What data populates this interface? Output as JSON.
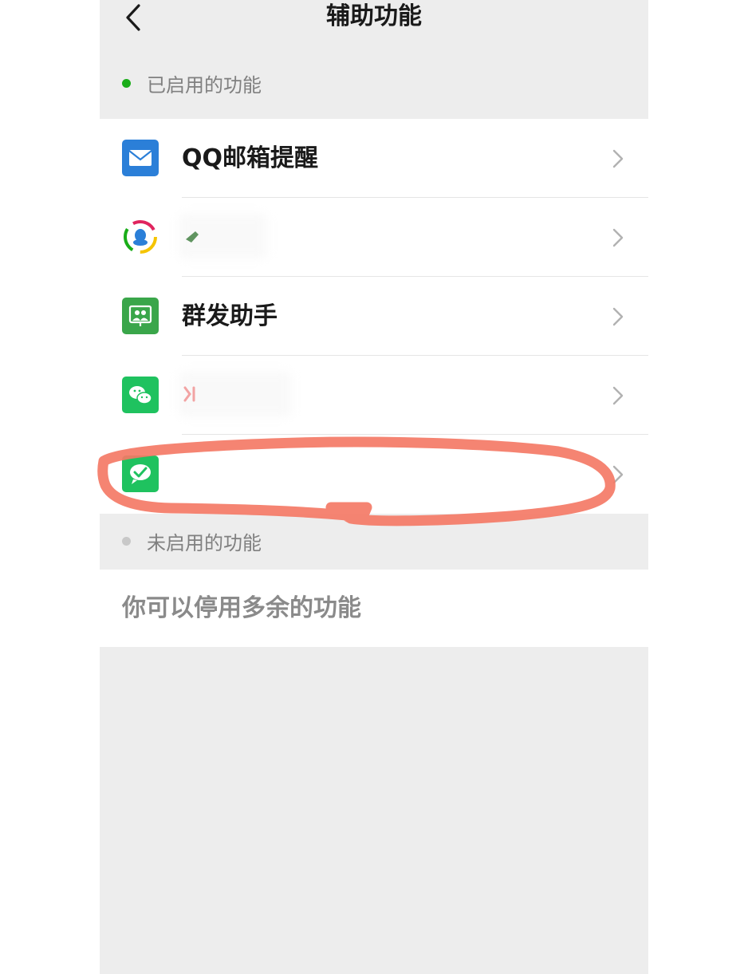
{
  "navbar": {
    "title": "辅助功能",
    "back_icon": "chevron-left-icon"
  },
  "enabled_section": {
    "label": "已启用的功能",
    "dot_color": "#1aad19"
  },
  "items": [
    {
      "label": "QQ邮箱提醒",
      "icon": "mail-icon",
      "icon_color": "#2b7fd8"
    },
    {
      "label": "",
      "icon": "qq-assistant-icon",
      "icon_color": "#ffffff"
    },
    {
      "label": "群发助手",
      "icon": "group-send-icon",
      "icon_color": "#3aa64a"
    },
    {
      "label": "",
      "icon": "wechat-icon",
      "icon_color": "#1fc25f"
    },
    {
      "label": "",
      "icon": "wechat-pay-icon",
      "icon_color": "#1fc25f"
    }
  ],
  "disabled_section": {
    "label": "未启用的功能",
    "dot_color": "#c8c8c8"
  },
  "note": {
    "text": "你可以停用多余的功能"
  },
  "annotation_color": "#f47a66"
}
